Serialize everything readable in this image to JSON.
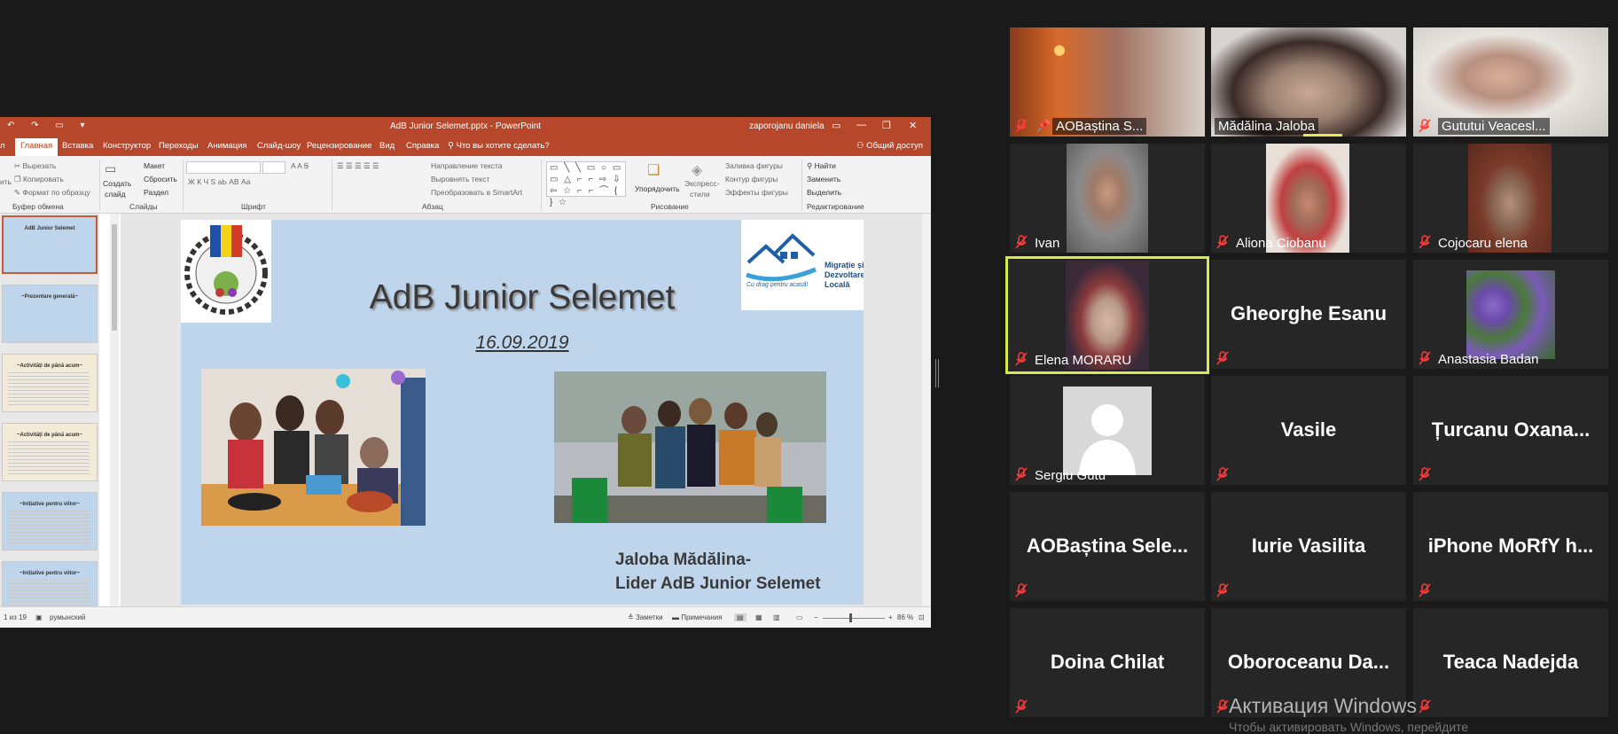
{
  "ppt": {
    "title": "AdB Junior Selemet.pptx - PowerPoint",
    "user": "zaporojanu daniela",
    "qat": "↶ ↷ ▭ ▾",
    "tabs": [
      "Главная",
      "Вставка",
      "Конструктор",
      "Переходы",
      "Анимация",
      "Слайд-шоу",
      "Рецензирование",
      "Вид",
      "Справка"
    ],
    "file_tab_partial": "л",
    "tell_me": "Что вы хотите сделать?",
    "share": "Общий доступ",
    "ribbon": {
      "clipboard": {
        "cut": "Вырезать",
        "copy": "Копировать",
        "format": "Формат по образцу",
        "paste_partial": "ить",
        "label": "Буфер обмена"
      },
      "slides": {
        "create1": "Создать",
        "create2": "слайд",
        "layout": "Макет",
        "reset": "Сбросить",
        "section": "Раздел",
        "label": "Слайды"
      },
      "font": {
        "label": "Шрифт",
        "format_row": "Ж К Ч S аЬ АВ Аа",
        "size_row": "A  A  Ꞩ"
      },
      "paragraph": {
        "text_dir": "Направление текста",
        "align": "Выровнять текст",
        "smartart": "Преобразовать в SmartArt",
        "label": "Абзац",
        "list_row": "☰ ☰ ☰ ☰ ☰"
      },
      "drawing": {
        "arrange": "Упорядочить",
        "quick1": "Экспресс-",
        "quick2": "стили",
        "fill": "Заливка фигуры",
        "outline": "Контур фигуры",
        "effects": "Эффекты фигуры",
        "label": "Рисование",
        "shapes": "▭ ╲ ╲ ▭ ○ ▭ ▭ △ ⌐ ⌐ ⇨ ⇩ ⇦ ☆ ⌐ ⌐ ⌒ { } ☆"
      },
      "editing": {
        "find": "Найти",
        "replace": "Заменить",
        "select": "Выделить",
        "label": "Редактирование"
      }
    },
    "thumbnails": [
      {
        "title": "AdB Junior Selemet",
        "bg": "#bfd5ec"
      },
      {
        "title": "~Prezentare generală~",
        "bg": "#bfd5ec"
      },
      {
        "title": "~Activități de până acum~",
        "bg": "#f3ead8"
      },
      {
        "title": "~Activități de până acum~",
        "bg": "#f3ead8"
      },
      {
        "title": "~Inițiative pentru viitor~",
        "bg": "#bfd5ec"
      },
      {
        "title": "~Inițiative pentru viitor~",
        "bg": "#bfd5ec"
      }
    ],
    "slide": {
      "title": "AdB Junior Selemet",
      "date": "16.09.2019",
      "author_line1": "Jaloba Mădălina-",
      "author_line2": "Lider AdB Junior Selemet",
      "logo_right_line1": "Migrație și",
      "logo_right_line2": "Dezvoltare",
      "logo_right_line3": "Locală",
      "logo_right_slogan": "Cu drag pentru acasă!"
    },
    "status": {
      "slide_count": "1 из 19",
      "language": "румынский",
      "notes": "Заметки",
      "comments": "Примечания",
      "zoom": "86 %"
    }
  },
  "participants": [
    {
      "name": "AOBaștina S...",
      "type": "video",
      "pinned": true,
      "muted": true
    },
    {
      "name": "Mădălina Jaloba",
      "type": "video",
      "pinned": false,
      "muted": false
    },
    {
      "name": "Gututui Veacesl...",
      "type": "video",
      "pinned": false,
      "muted": true
    },
    {
      "name": "Ivan",
      "type": "video",
      "pinned": false,
      "muted": true
    },
    {
      "name": "Aliona Ciobanu",
      "type": "video",
      "pinned": false,
      "muted": true
    },
    {
      "name": "Cojocaru elena",
      "type": "video",
      "pinned": false,
      "muted": true
    },
    {
      "name": "Elena MORARU",
      "type": "video",
      "pinned": false,
      "muted": true,
      "active": true
    },
    {
      "name": "Gheorghe Esanu",
      "type": "name",
      "muted": true
    },
    {
      "name": "Anastasia Badan",
      "type": "photo",
      "muted": true
    },
    {
      "name": "Sergiu Gutu",
      "type": "avatar",
      "muted": true
    },
    {
      "name": "Vasile",
      "type": "name",
      "muted": true
    },
    {
      "name": "Țurcanu Oxana...",
      "type": "name",
      "muted": true
    },
    {
      "name": "AOBaștina Sele...",
      "type": "name",
      "muted": true
    },
    {
      "name": "Iurie Vasilita",
      "type": "name",
      "muted": true
    },
    {
      "name": "iPhone MoRfY h...",
      "type": "name",
      "muted": true
    },
    {
      "name": "Doina Chilat",
      "type": "name",
      "muted": true
    },
    {
      "name": "Oboroceanu Da...",
      "type": "name",
      "muted": true
    },
    {
      "name": "Teaca Nadejda",
      "type": "name",
      "muted": true
    }
  ],
  "watermark": "Активация Windows",
  "watermark_sub": "Чтобы активировать Windows, перейдите"
}
